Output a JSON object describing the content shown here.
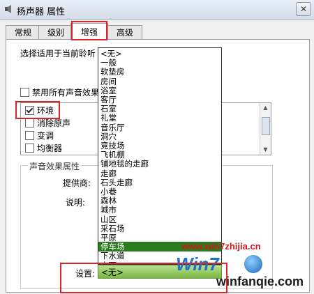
{
  "window": {
    "title": "扬声器 属性",
    "close_glyph": "✕"
  },
  "tabs": [
    {
      "label": "常规"
    },
    {
      "label": "级别"
    },
    {
      "label": "增强",
      "active": true
    },
    {
      "label": "高级"
    }
  ],
  "enhance": {
    "description": "选择适用于当前聆听                         更改才会生效。",
    "disable_all_label": "禁用所有声音效果",
    "disable_all_checked": false,
    "effects": [
      {
        "label": "环境",
        "checked": true
      },
      {
        "label": "消除原声",
        "checked": false
      },
      {
        "label": "变调",
        "checked": false
      },
      {
        "label": "均衡器",
        "checked": false
      }
    ],
    "properties": {
      "group_title": "声音效果属性",
      "provider_label": "提供商:",
      "description_label": "说明:",
      "settings_label": "设置:",
      "settings_value": "<无>"
    }
  },
  "dropdown": {
    "options": [
      "<无>",
      "一般",
      "软垫房",
      "房间",
      "浴室",
      "客厅",
      "石室",
      "礼堂",
      "音乐厅",
      "洞穴",
      "竞技场",
      "飞机棚",
      "铺地毯的走廊",
      "走廊",
      "石头走廊",
      "小巷",
      "森林",
      "城市",
      "山区",
      "采石场",
      "平原",
      "停车场",
      "下水道",
      "水下"
    ],
    "selected": "停车场"
  },
  "watermark": {
    "url_top": "www.win7zhijia.cn",
    "logo": "Win7",
    "url_bottom": "winfanqie.com"
  },
  "colors": {
    "highlight": "#d8262a",
    "selected_option": "#2a7a1e",
    "settings_combo": "#8fd05a"
  }
}
